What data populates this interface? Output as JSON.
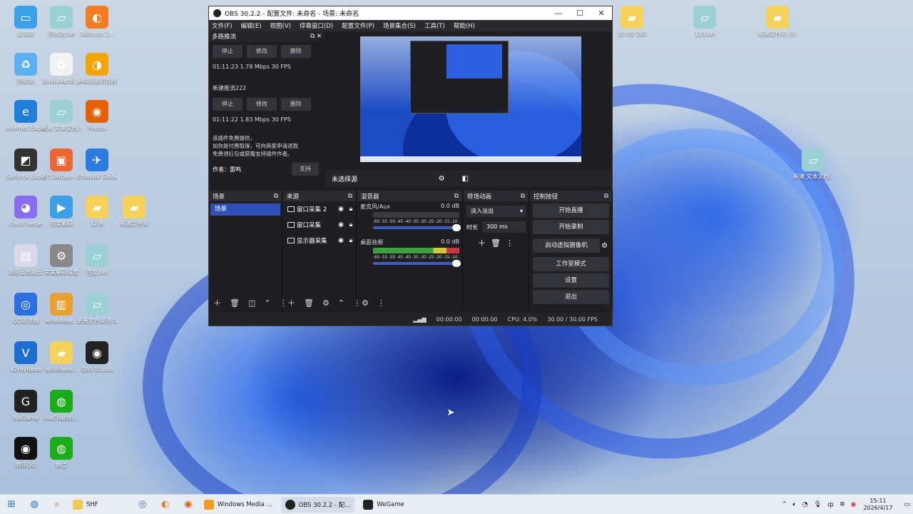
{
  "desktop": {
    "icons": [
      {
        "label": "此电脑",
        "color": "#3aa0e8",
        "glyph": "▭"
      },
      {
        "label": "回收站",
        "color": "#5db0f0",
        "glyph": "♻"
      },
      {
        "label": "Internet Explorer",
        "color": "#1f7ed8",
        "glyph": "e"
      },
      {
        "label": "GeForce Experience",
        "color": "#333",
        "glyph": "◩"
      },
      {
        "label": "clash Verge",
        "color": "#8a6cf0",
        "glyph": "◕"
      },
      {
        "label": "网易云电脑云",
        "color": "#d9d9e8",
        "glyph": "▤"
      },
      {
        "label": "QQ浏览器",
        "color": "#2b6fe0",
        "glyph": "◎"
      },
      {
        "label": "v2rayNexe",
        "color": "#1c6dd0",
        "glyph": "V"
      },
      {
        "label": "WeGame",
        "color": "#222",
        "glyph": "G"
      },
      {
        "label": "腾讯QQ",
        "color": "#111",
        "glyph": "◉"
      },
      {
        "label": "回收站.txt",
        "color": "#9bd0d6",
        "glyph": "▱"
      },
      {
        "label": "BaiduNetdi...",
        "color": "#f2f2f2",
        "glyph": "✿"
      },
      {
        "label": "新建 文本文档.txt",
        "color": "#9bd0d6",
        "glyph": "▱"
      },
      {
        "label": "[?] Docker-...",
        "color": "#e63",
        "glyph": "▣"
      },
      {
        "label": "完美解码",
        "color": "#3aa0e8",
        "glyph": "▶"
      },
      {
        "label": "完美解码设置",
        "color": "#888",
        "glyph": "⚙"
      },
      {
        "label": "win64exe...",
        "color": "#e8a030",
        "glyph": "▥"
      },
      {
        "label": "win64exe...",
        "color": "#f7d25a",
        "glyph": "▰"
      },
      {
        "label": "WeChatWi...",
        "color": "#1aad19",
        "glyph": "◍"
      },
      {
        "label": "微信",
        "color": "#1aad19",
        "glyph": "◍"
      },
      {
        "label": "360cccy 2...",
        "color": "#f47b20",
        "glyph": "◐"
      },
      {
        "label": "360极速浏览器X",
        "color": "#f6a400",
        "glyph": "◑"
      },
      {
        "label": "Firefox",
        "color": "#e66000",
        "glyph": "◉"
      },
      {
        "label": "ThinkAV GlobeDown",
        "color": "#2b7be0",
        "glyph": "✈"
      },
      {
        "label": "123s",
        "color": "#f7d25a",
        "glyph": "▰"
      },
      {
        "label": "百度.txt",
        "color": "#9bd0d6",
        "glyph": "▱"
      },
      {
        "label": "更新文件说明.txt",
        "color": "#9bd0d6",
        "glyph": "▱"
      },
      {
        "label": "OBS Studio",
        "color": "#222",
        "glyph": "◉"
      },
      {
        "label": "新建文件夹",
        "color": "#f7d25a",
        "glyph": "▰"
      },
      {
        "label": "30 00 180",
        "color": "#f7d25a",
        "glyph": "▰"
      },
      {
        "label": "123.txt",
        "color": "#9bd0d6",
        "glyph": "▱"
      },
      {
        "label": "新建文件夹 (3)",
        "color": "#f7d25a",
        "glyph": "▰"
      },
      {
        "label": "新建 文本文档 (3).txt",
        "color": "#9bd0d6",
        "glyph": "▱"
      }
    ]
  },
  "obs": {
    "title": "OBS 30.2.2 - 配置文件: 未命名 - 场景: 未命名",
    "menu": [
      "文件(F)",
      "编辑(E)",
      "视图(V)",
      "停靠窗口(D)",
      "配置文件(P)",
      "场景集合(S)",
      "工具(T)",
      "帮助(H)"
    ],
    "stream_dock": {
      "title": "多路推流",
      "buttons": [
        "停止",
        "修改",
        "删除"
      ],
      "stat1": "01:11:23 1.78 Mbps 30 FPS",
      "name2": "新建推流222",
      "stat2": "01:11:22 1.83 Mbps 30 FPS",
      "note1": "该插件免费提供，",
      "note2": "如你是付费取得，可向商家申请退款",
      "note3": "免费领红包或获赠支持插件作者。",
      "author": "作者：雷鸣",
      "support": "支持"
    },
    "preview_bar": {
      "label": "未选择源"
    },
    "scenes": {
      "title": "场景",
      "items": [
        "场景"
      ]
    },
    "sources": {
      "title": "来源",
      "items": [
        "窗口采集 2",
        "窗口采集",
        "显示器采集"
      ]
    },
    "mixer": {
      "title": "混音器",
      "channels": [
        {
          "name": "麦克风/Aux",
          "db": "0.0 dB",
          "scale": "-60 -55 -50 -45 -40 -35 -30 -25 -20 -15 -10 -5 0"
        },
        {
          "name": "桌面音频",
          "db": "0.0 dB",
          "scale": "-60 -55 -50 -45 -40 -35 -30 -25 -20 -15 -10 -5 0"
        }
      ]
    },
    "transitions": {
      "title": "转场动画",
      "selected": "淡入淡出",
      "duration_label": "时长",
      "duration": "300 ms"
    },
    "controls": {
      "title": "控制按钮",
      "buttons": [
        "开始直播",
        "开始录制",
        "启动虚拟摄像机",
        "工作室模式",
        "设置",
        "退出"
      ]
    },
    "status": {
      "rec": "00:00:00",
      "stream": "00:00:00",
      "cpu": "CPU: 4.0%",
      "fps": "30.00 / 30.00 FPS"
    }
  },
  "taskbar": {
    "apps": [
      "SHF",
      "Windows Media ...",
      "OBS 30.2.2 - 配...",
      "WeGame"
    ],
    "time": "15:11",
    "date": "2026/4/17"
  }
}
